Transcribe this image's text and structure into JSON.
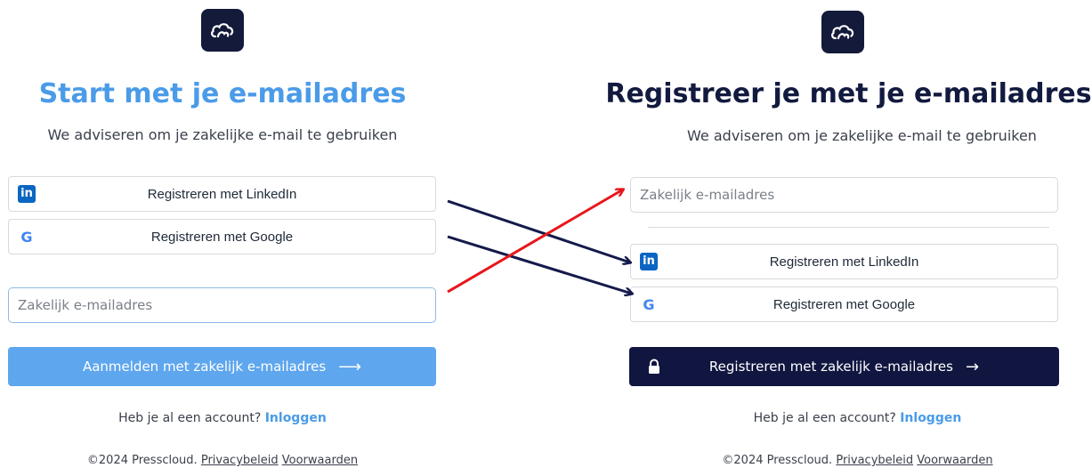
{
  "left": {
    "title": "Start met je e-mailadres",
    "subtitle": "We adviseren om je zakelijke e-mail te gebruiken",
    "linkedin_label": "Registreren met LinkedIn",
    "google_label": "Registreren met Google",
    "email_placeholder": "Zakelijk e-mailadres",
    "cta_label": "Aanmelden met zakelijk e-mailadres",
    "account_prompt": "Heb je al een account?",
    "login_label": "Inloggen",
    "copyright": "©2024 Presscloud.",
    "privacy_label": "Privacybeleid",
    "terms_label": "Voorwaarden"
  },
  "right": {
    "title": "Registreer je met je e-mailadres",
    "subtitle": "We adviseren om je zakelijke e-mail te gebruiken",
    "email_placeholder": "Zakelijk e-mailadres",
    "linkedin_label": "Registreren met LinkedIn",
    "google_label": "Registreren met Google",
    "cta_label": "Registreren met zakelijk e-mailadres",
    "account_prompt": "Heb je al een account?",
    "login_label": "Inloggen",
    "copyright": "©2024 Presscloud.",
    "privacy_label": "Privacybeleid",
    "terms_label": "Voorwaarden"
  },
  "icons": {
    "logo": "cloud-logo-icon",
    "linkedin": "linkedin-icon",
    "google": "google-icon",
    "arrow": "arrow-right-icon",
    "lock": "lock-icon"
  },
  "colors": {
    "brand_navy": "#101640",
    "accent_blue": "#4a9be8",
    "annotation_navy": "#141a4a",
    "annotation_red": "#e8161b"
  }
}
